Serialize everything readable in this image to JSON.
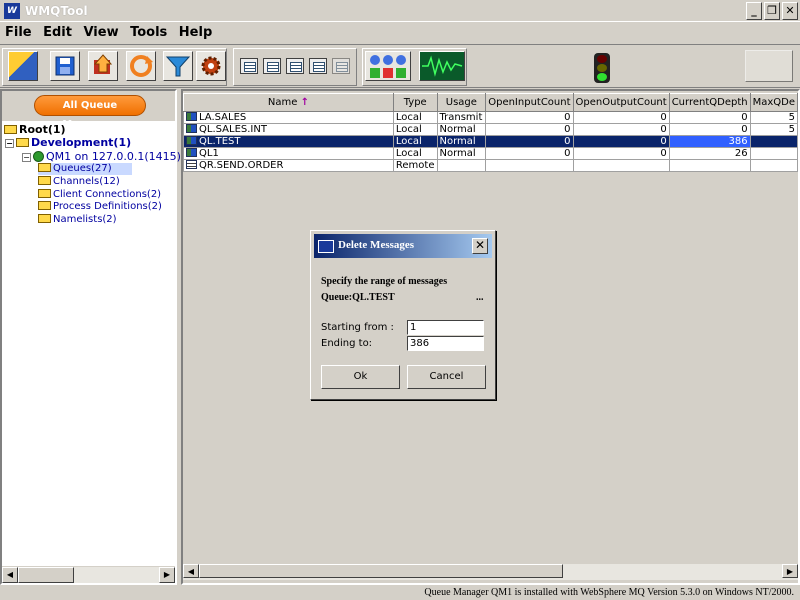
{
  "window": {
    "title": "WMQTool",
    "icon_text": "W",
    "controls": {
      "minimize": "_",
      "restore": "❐",
      "close": "✕"
    }
  },
  "menu": [
    "File",
    "Edit",
    "View",
    "Tools",
    "Help"
  ],
  "toolbar": {
    "icons": [
      "exit-icon",
      "save-icon",
      "upload-icon",
      "refresh-icon",
      "filter-icon",
      "settings-icon",
      "view-icon-1",
      "view-icon-2",
      "view-icon-3",
      "view-icon-4",
      "view-icon-5",
      "status-lights-icon",
      "monitor-icon",
      "traffic-light-icon",
      "panel-icon"
    ]
  },
  "sidebar": {
    "all_qm_label": "All Queue Managers",
    "tree": {
      "root": "Root(1)",
      "development": "Development(1)",
      "qm1": "QM1 on 127.0.0.1(1415)",
      "queues": "Queues(27)",
      "channels": "Channels(12)",
      "client_connections": "Client Connections(2)",
      "process_definitions": "Process Definitions(2)",
      "namelists": "Namelists(2)"
    }
  },
  "table": {
    "columns": [
      "Name",
      "Type",
      "Usage",
      "OpenInputCount",
      "OpenOutputCount",
      "CurrentQDepth",
      "MaxQDe"
    ],
    "sort_arrow": "↑",
    "rows": [
      {
        "name": "LA.SALES",
        "type": "Local",
        "usage": "Transmit",
        "in": "0",
        "out": "0",
        "depth": "0",
        "max": "5"
      },
      {
        "name": "QL.SALES.INT",
        "type": "Local",
        "usage": "Normal",
        "in": "0",
        "out": "0",
        "depth": "0",
        "max": "5"
      },
      {
        "name": "QL.TEST",
        "type": "Local",
        "usage": "Normal",
        "in": "0",
        "out": "0",
        "depth": "386",
        "max": ""
      },
      {
        "name": "QL1",
        "type": "Local",
        "usage": "Normal",
        "in": "0",
        "out": "0",
        "depth": "26",
        "max": ""
      },
      {
        "name": "QR.SEND.ORDER",
        "type": "Remote",
        "usage": "",
        "in": "",
        "out": "",
        "depth": "",
        "max": ""
      }
    ]
  },
  "dialog": {
    "title": "Delete Messages",
    "heading": "Specify the range of messages",
    "queue_label": "Queue:QL.TEST",
    "ellipsis": "...",
    "start_label": "Starting from :",
    "start_value": "1",
    "end_label": "Ending to:",
    "end_value": "386",
    "ok": "Ok",
    "cancel": "Cancel",
    "close": "✕"
  },
  "status": "Queue Manager QM1 is installed with WebSphere MQ Version 5.3.0 on Windows NT/2000."
}
